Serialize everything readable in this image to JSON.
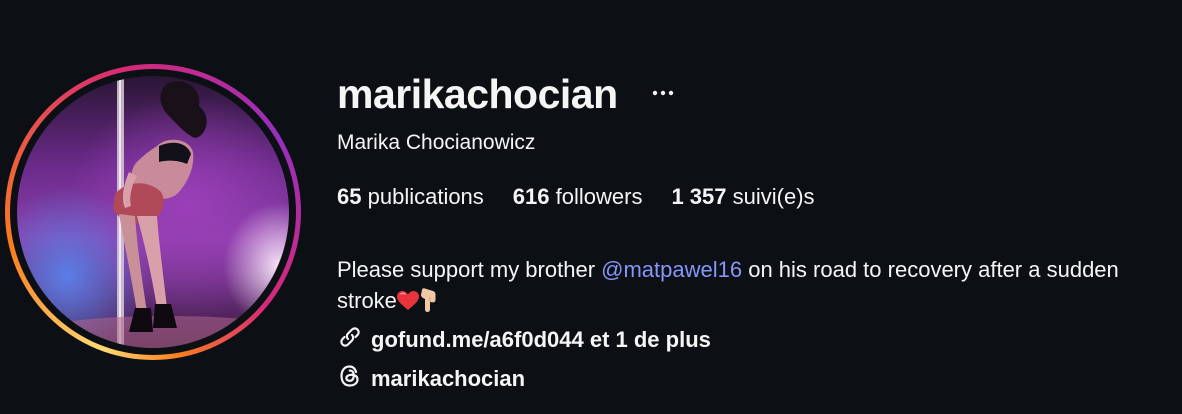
{
  "profile": {
    "username": "marikachocian",
    "full_name": "Marika Chocianowicz",
    "avatar_alt": "profile-photo"
  },
  "stats": {
    "posts_count": "65",
    "posts_label": "publications",
    "followers_count": "616",
    "followers_label": "followers",
    "following_count": "1 357",
    "following_label": "suivi(e)s"
  },
  "bio": {
    "text_before": "Please support my brother ",
    "mention": "@matpawel16",
    "text_after": " on his road to recovery after a sudden stroke"
  },
  "links": {
    "url_text": "gofund.me/a6f0d044 et 1 de plus",
    "threads_handle": "marikachocian"
  },
  "icons": {
    "more": "more-options-icon",
    "link": "link-icon",
    "threads": "threads-icon"
  },
  "colors": {
    "background": "#0c1014",
    "text": "#f5f5f5",
    "mention": "#8696f9"
  }
}
